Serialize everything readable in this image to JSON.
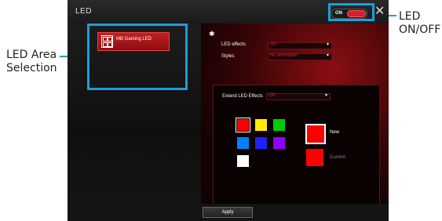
{
  "window": {
    "title": "LED",
    "toggle_label": "ON",
    "close_glyph": "✕"
  },
  "led_area": {
    "items": [
      {
        "label": "MB Gaming LED"
      }
    ]
  },
  "settings": {
    "led_effects_label": "LED effects",
    "led_effects_value": "On",
    "styles_label": "Styles",
    "styles_value": "No animation"
  },
  "extend": {
    "label": "Extend LED Effects",
    "value": "Off",
    "swatches": [
      "#ff0000",
      "#ffee00",
      "#00cc00",
      "#0080ff",
      "#2020ff",
      "#9000ff",
      "#ffffff"
    ],
    "new_label": "New",
    "current_label": "Current",
    "new_color": "#ff0000",
    "current_color": "#ff0000"
  },
  "footer": {
    "apply_label": "Apply"
  },
  "annotations": {
    "led_area_line1": "LED Area",
    "led_area_line2": "Selection",
    "led_onoff_line1": "LED",
    "led_onoff_line2": "ON/OFF",
    "highlight_color": "#1a9fdc"
  }
}
